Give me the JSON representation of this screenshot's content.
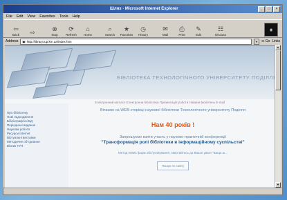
{
  "window": {
    "title": "Шлях - Microsoft Internet Explorer"
  },
  "menu": [
    "File",
    "Edit",
    "View",
    "Favorites",
    "Tools",
    "Help"
  ],
  "toolbar": [
    {
      "label": "Back",
      "icon": "back-arrow-icon",
      "glyph": "⇦"
    },
    {
      "label": "",
      "icon": "forward-arrow-icon",
      "glyph": "⇨"
    },
    {
      "label": "Stop",
      "icon": "stop-icon",
      "glyph": "⊗"
    },
    {
      "label": "Refresh",
      "icon": "refresh-icon",
      "glyph": "⟳"
    },
    {
      "label": "Home",
      "icon": "home-icon",
      "glyph": "⌂"
    },
    {
      "label": "Search",
      "icon": "search-icon",
      "glyph": "⌕"
    },
    {
      "label": "Favorites",
      "icon": "favorites-icon",
      "glyph": "★"
    },
    {
      "label": "History",
      "icon": "history-icon",
      "glyph": "◷"
    },
    {
      "label": "Mail",
      "icon": "mail-icon",
      "glyph": "✉"
    },
    {
      "label": "Print",
      "icon": "print-icon",
      "glyph": "⎙"
    },
    {
      "label": "Edit",
      "icon": "edit-icon",
      "glyph": "✎"
    },
    {
      "label": "Discuss",
      "icon": "discuss-icon",
      "glyph": "☷"
    }
  ],
  "address": {
    "label": "Address",
    "url": "http://library.tup.km.ua/index.htm",
    "go": "Go",
    "links": "Links"
  },
  "page": {
    "site_title": "БІБЛІОТЕКА ТЕХНОЛОГІЧНОГО УНІВЕРСИТЕТУ ПОДІЛЛЯ",
    "nav": "Електронний каталог Електронна бібліотека Презентація роботи Новини Бюлетень E-mail",
    "welcome": "Вітаємо на WEB-сторінці наукової бібліотеки Технологічного університету Поділля",
    "anniversary": "Нам 40 років !",
    "invite": "Запрошуємо взяти участь у науково-практичній конференції",
    "conference": "\"Трансформація ролі бібліотеки в інформаційному суспільстві\"",
    "note": "Метод нових форм обслуговування, звертайтесь до Вашої уваги \"Вища ш...",
    "search_button": "Пошук по сайту",
    "sidebar": [
      "Про бібліотеку",
      "Нові надходження",
      "Бібліографічні БД",
      "Періодичні видання",
      "Наукова робота",
      "Ресурси Internet",
      "Віртуальні виставки",
      "Методичне об'єднання",
      "Вісник ТУП"
    ]
  },
  "colors": {
    "accent": "#e05a14",
    "link": "#1e5a8f",
    "title_bar": "#1c3f8c"
  }
}
